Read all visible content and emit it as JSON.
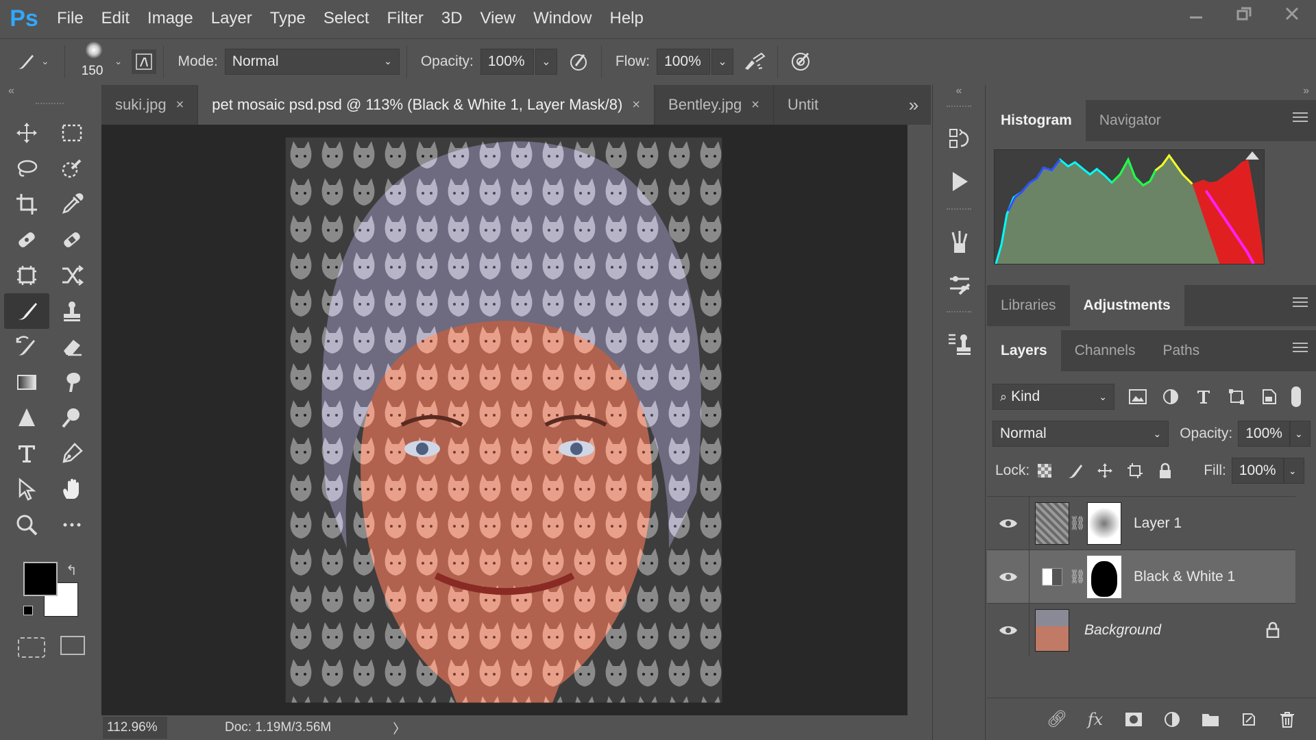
{
  "app": {
    "logo": "Ps",
    "menu": [
      "File",
      "Edit",
      "Image",
      "Layer",
      "Type",
      "Select",
      "Filter",
      "3D",
      "View",
      "Window",
      "Help"
    ],
    "window_controls": [
      "minimize-icon",
      "restore-icon",
      "close-icon"
    ]
  },
  "options_bar": {
    "brush_size": "150",
    "mode_label": "Mode:",
    "mode_value": "Normal",
    "opacity_label": "Opacity:",
    "opacity_value": "100%",
    "flow_label": "Flow:",
    "flow_value": "100%"
  },
  "tabs": [
    {
      "label": "suki.jpg",
      "active": false
    },
    {
      "label": "pet mosaic psd.psd @ 113% (Black & White 1, Layer Mask/8)",
      "active": true
    },
    {
      "label": "Bentley.jpg",
      "active": false
    },
    {
      "label": "Untit",
      "active": false
    }
  ],
  "tab_overflow": "»",
  "status": {
    "zoom": "112.96%",
    "doc": "Doc: 1.19M/3.56M",
    "arrow": "〉"
  },
  "colors": {
    "foreground": "#000000",
    "background": "#ffffff",
    "accent": "#31a8ff"
  },
  "tools": [
    "move-icon",
    "marquee-icon",
    "lasso-icon",
    "quick-select-icon",
    "crop-icon",
    "eyedropper-icon",
    "spot-healing-icon",
    "healing-icon",
    "frame-icon",
    "content-aware-move-icon",
    "brush-icon",
    "stamp-icon",
    "history-brush-icon",
    "eraser-icon",
    "gradient-icon",
    "smudge-icon",
    "sharpen-icon",
    "dodge-icon",
    "type-icon",
    "pen-icon",
    "path-select-icon",
    "hand-icon",
    "zoom-icon",
    "more-icon"
  ],
  "panels": {
    "top_tabs": [
      "Histogram",
      "Navigator"
    ],
    "mid_tabs": [
      "Libraries",
      "Adjustments"
    ],
    "layer_tabs": [
      "Layers",
      "Channels",
      "Paths"
    ],
    "kind_label": "Kind",
    "blend_mode": "Normal",
    "opacity_label": "Opacity:",
    "opacity_value": "100%",
    "lock_label": "Lock:",
    "fill_label": "Fill:",
    "fill_value": "100%",
    "layers": [
      {
        "name": "Layer 1",
        "visible": true,
        "selected": false,
        "italic": false
      },
      {
        "name": "Black & White 1",
        "visible": true,
        "selected": true,
        "italic": false
      },
      {
        "name": "Background",
        "visible": true,
        "selected": false,
        "italic": true,
        "locked": true
      }
    ]
  }
}
